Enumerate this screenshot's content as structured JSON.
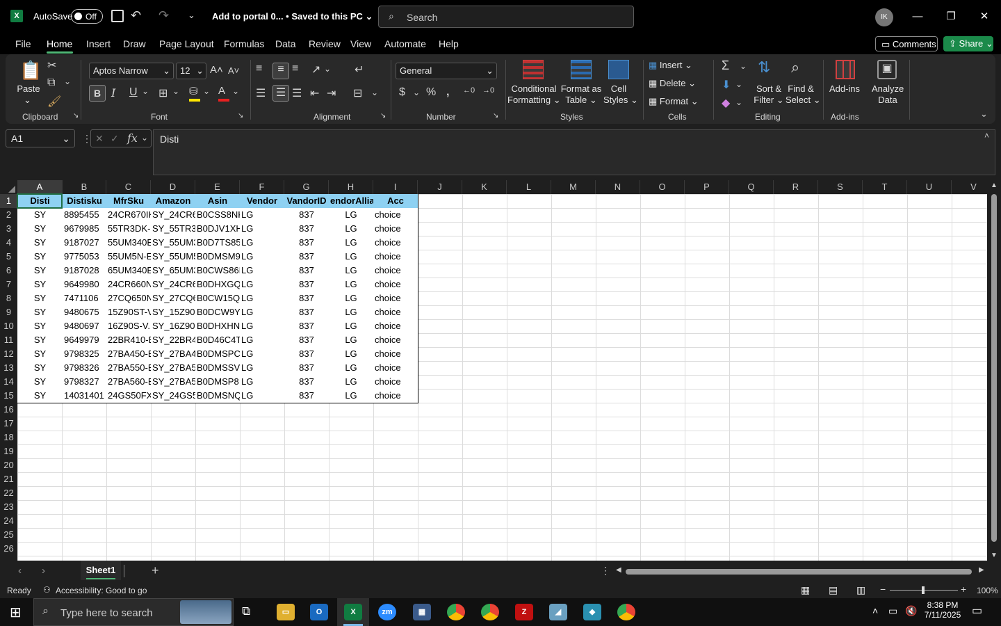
{
  "titlebar": {
    "app_icon": "X",
    "autosave_label": "AutoSave",
    "autosave_state": "Off",
    "doc_title": "Add to portal 0... • Saved to this PC",
    "search_placeholder": "Search",
    "avatar_initials": "IK"
  },
  "menu": [
    "File",
    "Home",
    "Insert",
    "Draw",
    "Page Layout",
    "Formulas",
    "Data",
    "Review",
    "View",
    "Automate",
    "Help"
  ],
  "actions": {
    "comments": "Comments",
    "share": "Share"
  },
  "ribbon": {
    "clipboard": {
      "paste": "Paste",
      "group": "Clipboard"
    },
    "font": {
      "name": "Aptos Narrow",
      "size": "12",
      "group": "Font"
    },
    "alignment": {
      "group": "Alignment"
    },
    "number": {
      "format": "General",
      "group": "Number"
    },
    "styles": {
      "conditional": [
        "Conditional",
        "Formatting"
      ],
      "format_table": [
        "Format as",
        "Table"
      ],
      "cell_styles": [
        "Cell",
        "Styles"
      ],
      "group": "Styles"
    },
    "cells": {
      "insert": "Insert",
      "delete": "Delete",
      "format": "Format",
      "group": "Cells"
    },
    "editing": {
      "sort": [
        "Sort &",
        "Filter"
      ],
      "find": [
        "Find &",
        "Select"
      ],
      "group": "Editing"
    },
    "addins": {
      "addins": "Add-ins",
      "analyze": [
        "Analyze",
        "Data"
      ],
      "group": "Add-ins"
    }
  },
  "formula": {
    "name_box": "A1",
    "content": "Disti"
  },
  "columns": [
    "A",
    "B",
    "C",
    "D",
    "E",
    "F",
    "G",
    "H",
    "I",
    "J",
    "K",
    "L",
    "M",
    "N",
    "O",
    "P",
    "Q",
    "R",
    "S",
    "T",
    "U",
    "V"
  ],
  "rows": [
    "1",
    "2",
    "3",
    "4",
    "5",
    "6",
    "7",
    "8",
    "9",
    "10",
    "11",
    "12",
    "13",
    "14",
    "15",
    "16",
    "17",
    "18",
    "19",
    "20",
    "21",
    "22",
    "23",
    "24",
    "25",
    "26"
  ],
  "table": {
    "headers": [
      "Disti",
      "Distisku",
      "MfrSku",
      "Amazon",
      "Asin",
      "Vendor",
      "VandorID",
      "endorAllia",
      "Acc"
    ],
    "rows": [
      [
        "SY",
        "8895455",
        "24CR670IK",
        "SY_24CR67",
        "B0CSS8NK",
        "LG",
        "837",
        "LG",
        "choice"
      ],
      [
        "SY",
        "9679985",
        "55TR3DK-I",
        "SY_55TR3D",
        "B0DJV1XH",
        "LG",
        "837",
        "LG",
        "choice"
      ],
      [
        "SY",
        "9187027",
        "55UM340E",
        "SY_55UM3",
        "B0D7TS85",
        "LG",
        "837",
        "LG",
        "choice"
      ],
      [
        "SY",
        "9775053",
        "55UM5N-E",
        "SY_55UM5",
        "B0DMSM9",
        "LG",
        "837",
        "LG",
        "choice"
      ],
      [
        "SY",
        "9187028",
        "65UM340E",
        "SY_65UM3",
        "B0CWS86L",
        "LG",
        "837",
        "LG",
        "choice"
      ],
      [
        "SY",
        "9649980",
        "24CR660N",
        "SY_24CR66",
        "B0DHXGQ",
        "LG",
        "837",
        "LG",
        "choice"
      ],
      [
        "SY",
        "7471106",
        "27CQ650N",
        "SY_27CQ6",
        "B0CW15Q",
        "LG",
        "837",
        "LG",
        "choice"
      ],
      [
        "SY",
        "9480675",
        "15Z90ST-V",
        "SY_15Z90S",
        "B0DCW9YJ",
        "LG",
        "837",
        "LG",
        "choice"
      ],
      [
        "SY",
        "9480697",
        "16Z90S-V.",
        "SY_16Z90S",
        "B0DHXHN",
        "LG",
        "837",
        "LG",
        "choice"
      ],
      [
        "SY",
        "9649979",
        "22BR410-E",
        "SY_22BR41",
        "B0D46C4T",
        "LG",
        "837",
        "LG",
        "choice"
      ],
      [
        "SY",
        "9798325",
        "27BA450-E",
        "SY_27BA45",
        "B0DMSPC",
        "LG",
        "837",
        "LG",
        "choice"
      ],
      [
        "SY",
        "9798326",
        "27BA550-E",
        "SY_27BA55",
        "B0DMSSV",
        "LG",
        "837",
        "LG",
        "choice"
      ],
      [
        "SY",
        "9798327",
        "27BA560-E",
        "SY_27BA56",
        "B0DMSP8",
        "LG",
        "837",
        "LG",
        "choice"
      ],
      [
        "SY",
        "14031401",
        "24GS50FX-",
        "SY_24GS50",
        "B0DMSNQ",
        "LG",
        "837",
        "LG",
        "choice"
      ]
    ]
  },
  "sheets": {
    "active": "Sheet1"
  },
  "status": {
    "ready": "Ready",
    "accessibility": "Accessibility: Good to go",
    "zoom": "100%"
  },
  "taskbar": {
    "search_placeholder": "Type here to search",
    "time": "8:38 PM",
    "date": "7/11/2025"
  }
}
